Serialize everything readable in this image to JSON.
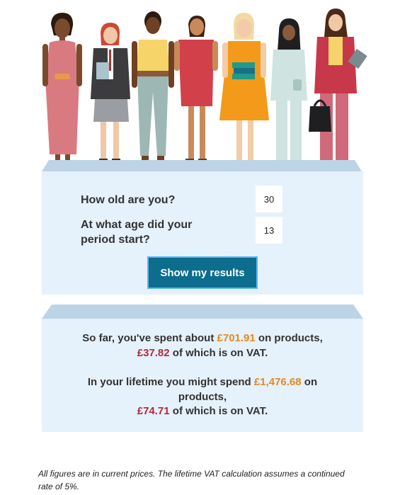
{
  "form": {
    "age_question": "How old are you?",
    "age_value": "30",
    "period_question_line1": "At what age did your",
    "period_question_line2": "period start?",
    "period_value": "13",
    "submit_label": "Show my results"
  },
  "results": {
    "spent_prefix": "So far, you've spent about ",
    "spent_amount": "£701.91",
    "spent_suffix": " on products,",
    "spent_vat_amount": "£37.82",
    "spent_vat_suffix": " of which is on VAT.",
    "lifetime_prefix": "In your lifetime you might spend ",
    "lifetime_amount": "£1,476.68",
    "lifetime_suffix": " on",
    "lifetime_suffix2": "products,",
    "lifetime_vat_amount": "£74.71",
    "lifetime_vat_suffix": " of which is on VAT."
  },
  "footnote": {
    "line1": "All figures are in current prices. The lifetime VAT calculation assumes a continued",
    "line2": "rate of 5%."
  },
  "colors": {
    "panel": "#e5f1fb",
    "stage_top": "#bcd4e6",
    "button": "#0c6d8f",
    "highlight_orange": "#e48a1e",
    "highlight_red": "#b02a3c"
  },
  "figures": [
    "woman-pink-dress",
    "schoolgirl-uniform",
    "woman-yellow-top",
    "woman-red-dress",
    "woman-orange-dress-books",
    "woman-hijab-suit",
    "woman-red-suit-handbag"
  ]
}
